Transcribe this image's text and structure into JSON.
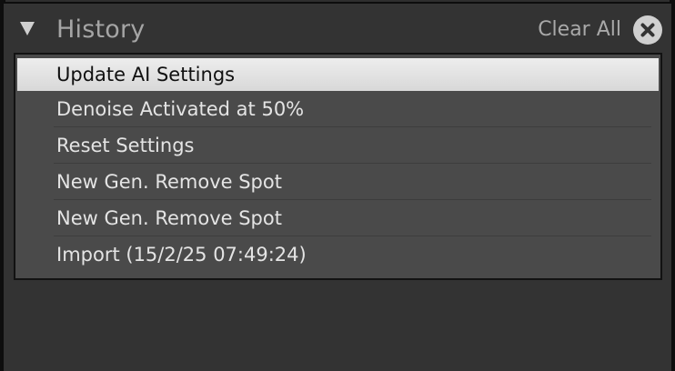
{
  "panel": {
    "title": "History",
    "clear_all_label": "Clear All",
    "disclosure_icon": "triangle-down-icon",
    "clear_icon": "close-circle-icon",
    "colors": {
      "background": "#333333",
      "list_background": "#4a4a4a",
      "selected_background": "#e6e6e6",
      "text": "#e4e4e4"
    }
  },
  "history": {
    "selected_index": 0,
    "items": [
      {
        "label": "Update AI Settings"
      },
      {
        "label": "Denoise Activated at 50%"
      },
      {
        "label": "Reset Settings"
      },
      {
        "label": "New Gen. Remove Spot"
      },
      {
        "label": "New Gen. Remove Spot"
      },
      {
        "label": "Import (15/2/25 07:49:24)"
      }
    ]
  }
}
